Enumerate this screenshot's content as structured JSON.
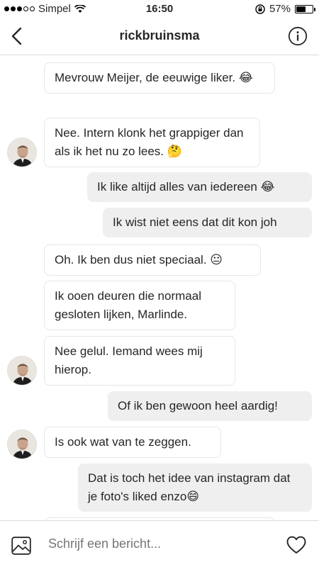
{
  "status": {
    "carrier": "Simpel",
    "time": "16:50",
    "battery": "57%",
    "battery_level": 0.57,
    "signal_bars": 3
  },
  "header": {
    "title": "rickbruinsma"
  },
  "messages": [
    {
      "dir": "in",
      "text": "Mevrouw Meijer, de eeuwige liker. 😂",
      "avatar": false
    },
    {
      "dir": "in",
      "text": "Nee. Intern klonk het grappiger dan als ik het nu zo lees. 🤔",
      "avatar": true
    },
    {
      "dir": "out",
      "text": "Ik like altijd alles van iedereen 😂"
    },
    {
      "dir": "out",
      "text": "Ik wist niet eens dat dit kon joh"
    },
    {
      "dir": "in",
      "text": "Oh. Ik ben dus niet speciaal. 😐",
      "avatar": false
    },
    {
      "dir": "in",
      "text": "Ik ooen deuren die normaal gesloten lijken, Marlinde.",
      "avatar": false
    },
    {
      "dir": "in",
      "text": "Nee gelul. Iemand wees mij hierop.",
      "avatar": true
    },
    {
      "dir": "out",
      "text": "Of ik ben gewoon heel aardig!"
    },
    {
      "dir": "in",
      "text": "Is ook wat van te zeggen.",
      "avatar": true
    },
    {
      "dir": "out",
      "text": "Dat is toch het idee van instagram dat je foto's liked enzo😄"
    }
  ],
  "composer": {
    "placeholder": "Schrijf een bericht..."
  }
}
